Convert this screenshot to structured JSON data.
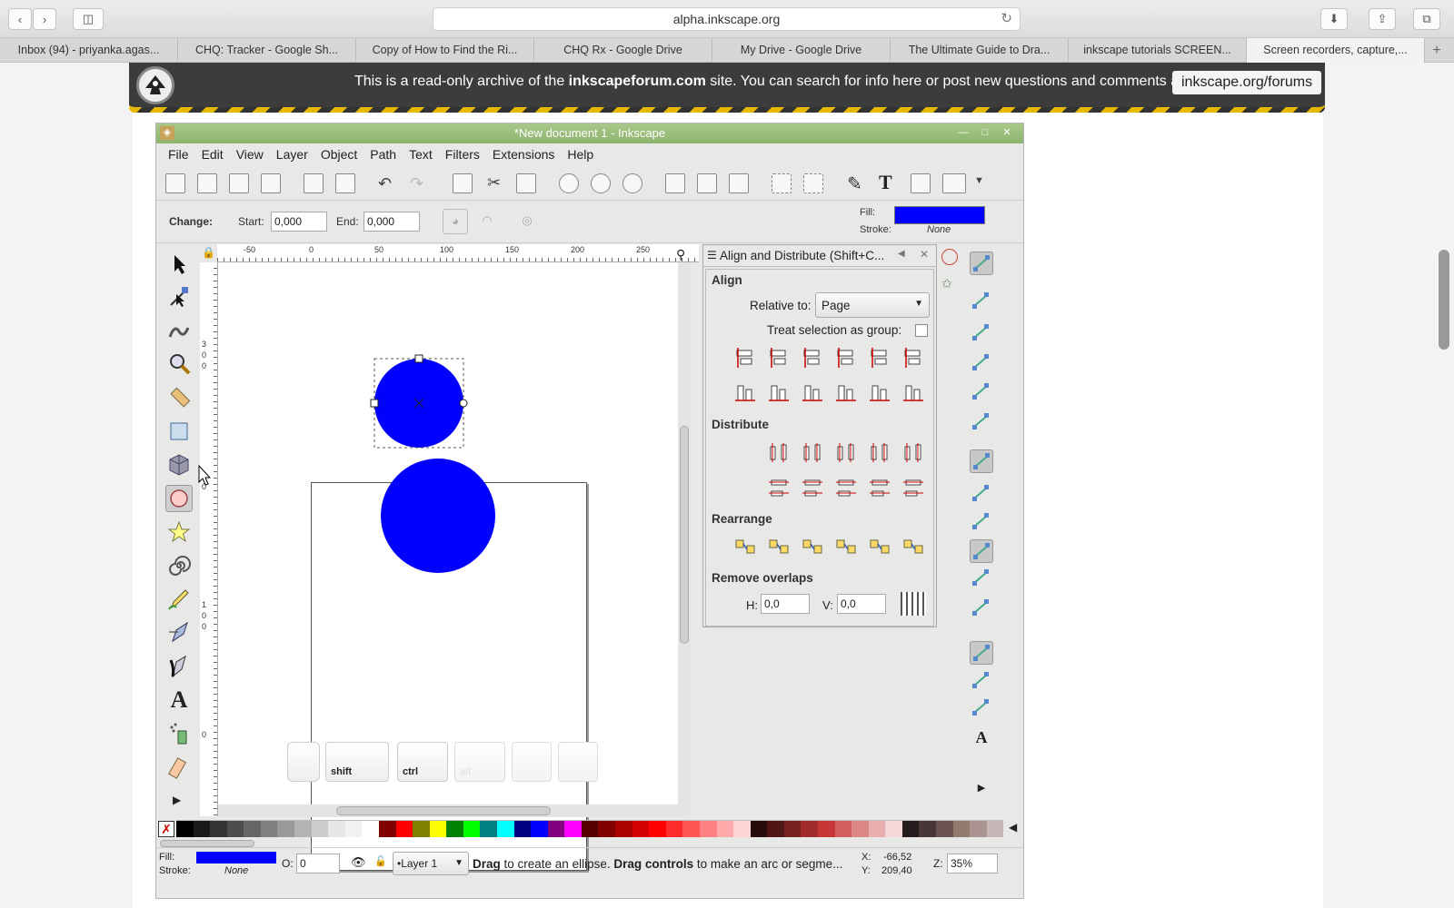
{
  "browser": {
    "url": "alpha.inkscape.org",
    "tabs": [
      "Inbox (94) - priyanka.agas...",
      "CHQ: Tracker - Google Sh...",
      "Copy of How to Find the Ri...",
      "CHQ Rx - Google Drive",
      "My Drive - Google Drive",
      "The Ultimate Guide to Dra...",
      "inkscape tutorials SCREEN...",
      "Screen recorders, capture,..."
    ],
    "active_tab": 7
  },
  "banner": {
    "text_pre": "This is a read-only archive of the",
    "text_bold": "inkscapeforum.com",
    "text_post": "site. You can search for info here or post new questions and comments at",
    "link": "inkscape.org/forums"
  },
  "inkscape": {
    "title": "*New document 1 - Inkscape",
    "menus": [
      "File",
      "Edit",
      "View",
      "Layer",
      "Object",
      "Path",
      "Text",
      "Filters",
      "Extensions",
      "Help"
    ],
    "tool_controls": {
      "change_label": "Change:",
      "start_label": "Start:",
      "start_value": "0,000",
      "end_label": "End:",
      "end_value": "0,000",
      "fill_label": "Fill:",
      "stroke_label": "Stroke:",
      "stroke_value": "None",
      "fill_color": "#0000ff"
    },
    "ruler_h": [
      "-50",
      "0",
      "50",
      "100",
      "150",
      "200",
      "250"
    ],
    "ruler_v": [
      "3",
      "0",
      "0",
      "0",
      "1",
      "0",
      "0",
      "0"
    ],
    "modifier_keys": [
      "",
      "shift",
      "ctrl",
      "alt",
      "",
      ""
    ],
    "align_dialog": {
      "title": "Align and Distribute (Shift+C...",
      "align_label": "Align",
      "relative_label": "Relative to:",
      "relative_value": "Page",
      "group_label": "Treat selection as group:",
      "distribute_label": "Distribute",
      "rearrange_label": "Rearrange",
      "overlaps_label": "Remove overlaps",
      "h_label": "H:",
      "h_value": "0,0",
      "v_label": "V:",
      "v_value": "0,0"
    },
    "status": {
      "fill_label": "Fill:",
      "stroke_label": "Stroke:",
      "stroke_value": "None",
      "opacity_label": "O:",
      "opacity_value": "0",
      "layer": "•Layer 1",
      "message_b1": "Drag",
      "message_t1": " to create an ellipse. ",
      "message_b2": "Drag controls",
      "message_t2": " to make an arc or segme...",
      "x_label": "X:",
      "x_value": "-66,52",
      "y_label": "Y:",
      "y_value": "209,40",
      "z_label": "Z:",
      "zoom": "35%"
    },
    "palette": [
      "#000000",
      "#1a1a1a",
      "#333333",
      "#4d4d4d",
      "#666666",
      "#808080",
      "#999999",
      "#b3b3b3",
      "#cccccc",
      "#e6e6e6",
      "#f2f2f2",
      "#ffffff",
      "#800000",
      "#ff0000",
      "#808000",
      "#ffff00",
      "#008000",
      "#00ff00",
      "#008080",
      "#00ffff",
      "#000080",
      "#0000ff",
      "#800080",
      "#ff00ff",
      "#550000",
      "#800000",
      "#aa0000",
      "#d40000",
      "#ff0000",
      "#ff2a2a",
      "#ff5555",
      "#ff8080",
      "#ffaaaa",
      "#ffd5d5",
      "#280b0b",
      "#501616",
      "#782121",
      "#a02c2c",
      "#c83737",
      "#d35f5f",
      "#de8787",
      "#e9afaf",
      "#f4d7d7",
      "#241c1c",
      "#483737",
      "#6c5353",
      "#917c6f",
      "#ac9393",
      "#c8b7b7"
    ]
  }
}
